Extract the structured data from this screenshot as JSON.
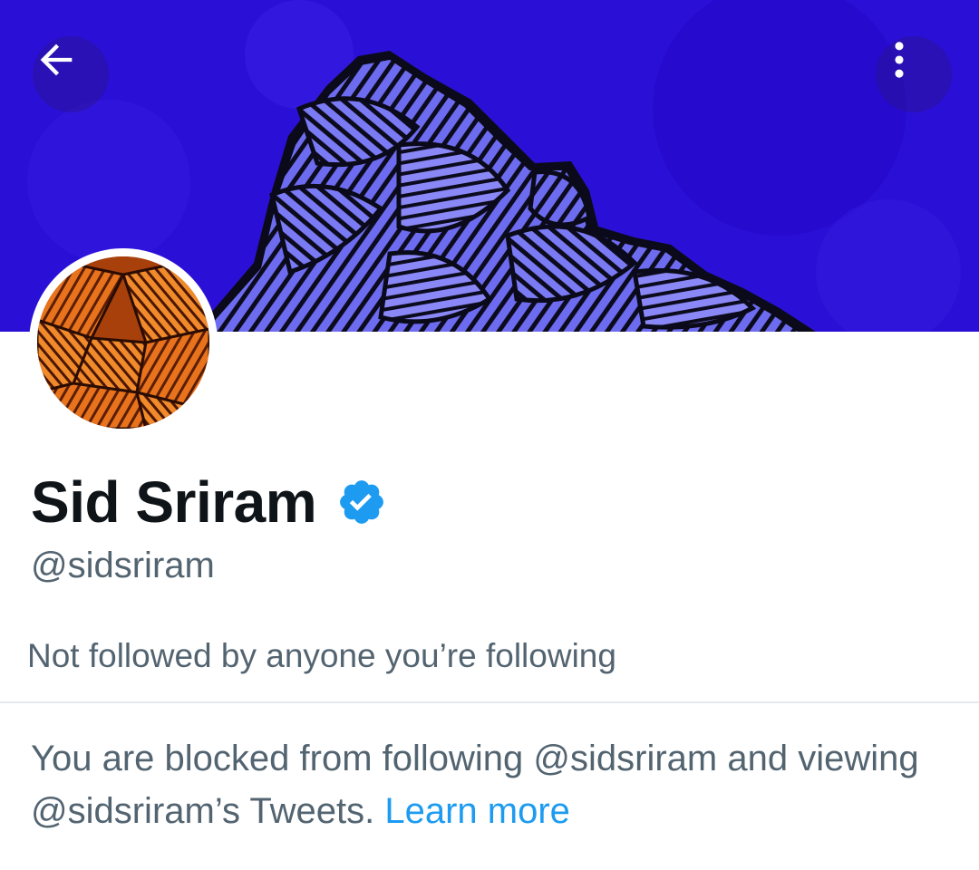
{
  "header": {
    "back_icon": "arrow-left-icon",
    "more_icon": "more-vertical-icon"
  },
  "banner": {
    "description_colors": {
      "background": "#2a10d6",
      "mountain_fill": "#6a68ee",
      "ink": "#0a0a18"
    }
  },
  "profile": {
    "display_name": "Sid Sriram",
    "verified_icon": "verified-badge-icon",
    "verified_color": "#1d9bf0",
    "handle": "@sidsriram",
    "followers_note": "Not followed by anyone you’re following"
  },
  "blocked": {
    "message": "You are blocked from following @sidsriram and viewing @sidsriram’s Tweets.",
    "link_label": "Learn more"
  }
}
